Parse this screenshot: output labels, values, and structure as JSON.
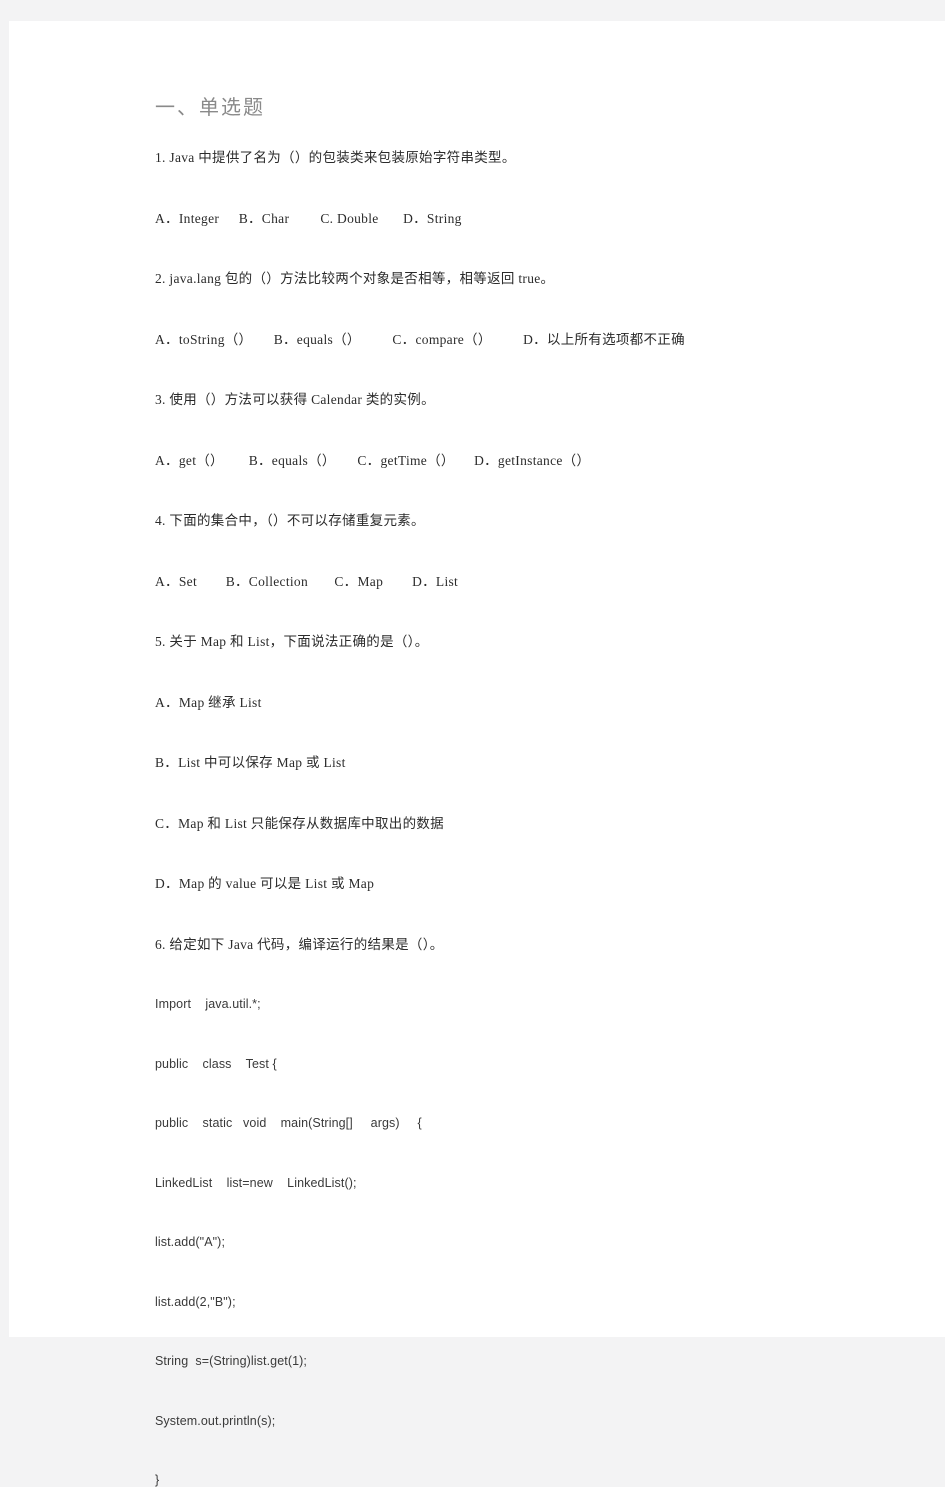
{
  "document": {
    "section_title": "一、单选题",
    "questions": [
      {
        "number": "1.",
        "text": "1.  Java 中提供了名为（）的包装类来包装原始字符串类型。",
        "options_inline": [
          "A．Integer",
          "B．Char",
          "C. Double",
          "D．String"
        ]
      },
      {
        "number": "2.",
        "text": "2.  java.lang 包的（）方法比较两个对象是否相等，相等返回 true。",
        "options_inline": [
          "A．toString（）",
          "B．equals（）",
          "C．compare（）",
          "D．以上所有选项都不正确"
        ]
      },
      {
        "number": "3.",
        "text": "3.  使用（）方法可以获得 Calendar 类的实例。",
        "options_inline": [
          "A．get（）",
          "B．equals（）",
          "C．getTime（）",
          "D．getInstance（）"
        ]
      },
      {
        "number": "4.",
        "text": "4.  下面的集合中，（）不可以存储重复元素。",
        "options_inline": [
          "A．Set",
          "B．Collection",
          "C．Map",
          "D．List"
        ]
      },
      {
        "number": "5.",
        "text": "5.  关于 Map 和 List，下面说法正确的是（）。",
        "options_block": [
          "A．Map 继承 List",
          "B．List 中可以保存 Map 或 List",
          "C．Map 和 List 只能保存从数据库中取出的数据",
          "D．Map 的 value 可以是 List 或 Map"
        ]
      },
      {
        "number": "6.",
        "text": "6.  给定如下 Java 代码，编译运行的结果是（）。",
        "code_lines": [
          "Import    java.util.*;",
          "public    class    Test {",
          "public    static   void    main(String[]     args)     {",
          "LinkedList    list=new    LinkedList();",
          "list.add(\"A\");",
          "list.add(2,\"B\");",
          "String  s=(String)list.get(1);",
          "System.out.println(s);",
          "}"
        ]
      }
    ]
  },
  "colors": {
    "page_background": "#ffffff",
    "canvas_background": "#f3f3f4",
    "body_text": "#2b2b2b",
    "title_text": "#8a8a8a",
    "code_text": "#3a3a3a"
  }
}
